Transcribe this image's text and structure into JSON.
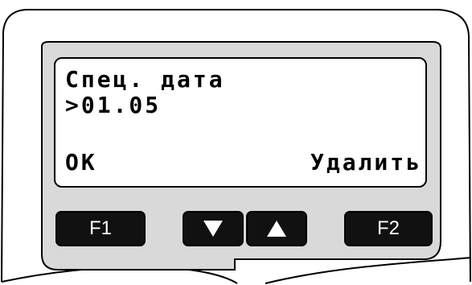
{
  "display": {
    "line1": "Спец. дата",
    "line2": ">01.05",
    "soft_left": "OK",
    "soft_right": "Удалить"
  },
  "keys": {
    "f1": "F1",
    "f2": "F2",
    "down_icon": "down-triangle-icon",
    "up_icon": "up-triangle-icon"
  },
  "colors": {
    "panel": "#d9d9d9",
    "key": "#111111",
    "key_text": "#ffffff",
    "lcd": "#ffffff"
  }
}
